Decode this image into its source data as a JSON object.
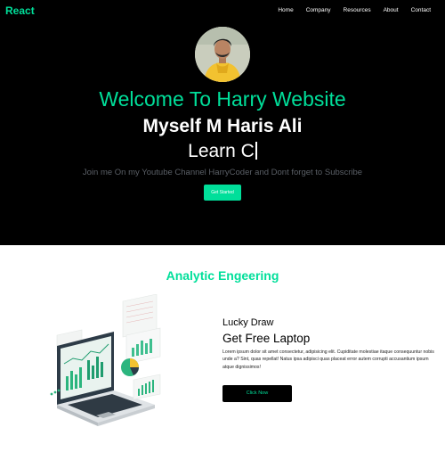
{
  "navbar": {
    "brand": "React",
    "links": [
      "Home",
      "Company",
      "Resources",
      "About",
      "Contact"
    ]
  },
  "hero": {
    "title": "Welcome To Harry Website",
    "subtitle": "Myself M Haris Ali",
    "typing_text": "Learn C",
    "description": "Join me On my Youtube Channel HarryCoder and Dont forget to Subscribe",
    "cta_label": "Get Started"
  },
  "analytics": {
    "title": "Analytic Engeering",
    "kicker": "Lucky Draw",
    "heading": "Get Free Laptop",
    "body": "Lorem ipsum dolor sit amet consectetur, adipisicing elit. Cupiditate molestiae itaque consequuntur nobis unde a? Sint, quas repellat! Natus ipsa adipisci quas placeat error autem corrupti accusantium ipsum atque dignissimos!",
    "button_label": "Click Now"
  },
  "colors": {
    "accent": "#00df9a",
    "hero_bg": "#000000",
    "page_bg": "#ffffff"
  },
  "icons": {
    "avatar": "profile-photo",
    "illustration": "laptop-analytics-illustration"
  }
}
